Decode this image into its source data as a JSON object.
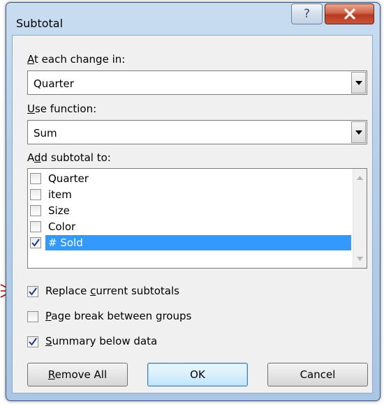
{
  "window": {
    "title": "Subtotal"
  },
  "title_bar": {
    "help_glyph": "?",
    "close_glyph": "X"
  },
  "change_in": {
    "label_key": "A",
    "label_rest": "t each change in:",
    "value": "Quarter"
  },
  "use_function": {
    "label_key": "U",
    "label_rest": "se function:",
    "value": "Sum"
  },
  "add_subtotal": {
    "label_pre": "A",
    "label_key": "d",
    "label_rest": "d subtotal to:",
    "items": [
      {
        "label": "Quarter",
        "checked": false,
        "selected": false
      },
      {
        "label": "item",
        "checked": false,
        "selected": false
      },
      {
        "label": "Size",
        "checked": false,
        "selected": false
      },
      {
        "label": "Color",
        "checked": false,
        "selected": false
      },
      {
        "label": "# Sold",
        "checked": true,
        "selected": true
      }
    ]
  },
  "options": {
    "replace": {
      "pre": "Replace ",
      "key": "c",
      "rest": "urrent subtotals",
      "checked": true
    },
    "page_break": {
      "pre": "",
      "key": "P",
      "rest": "age break between groups",
      "checked": false
    },
    "summary": {
      "pre": "",
      "key": "S",
      "rest": "ummary below data",
      "checked": true
    }
  },
  "buttons": {
    "remove_all_key": "R",
    "remove_all_rest": "emove All",
    "ok": "OK",
    "cancel": "Cancel"
  },
  "colors": {
    "selection": "#3399ff",
    "annotation_arrow": "#c00000",
    "check": "#1f3a93"
  }
}
